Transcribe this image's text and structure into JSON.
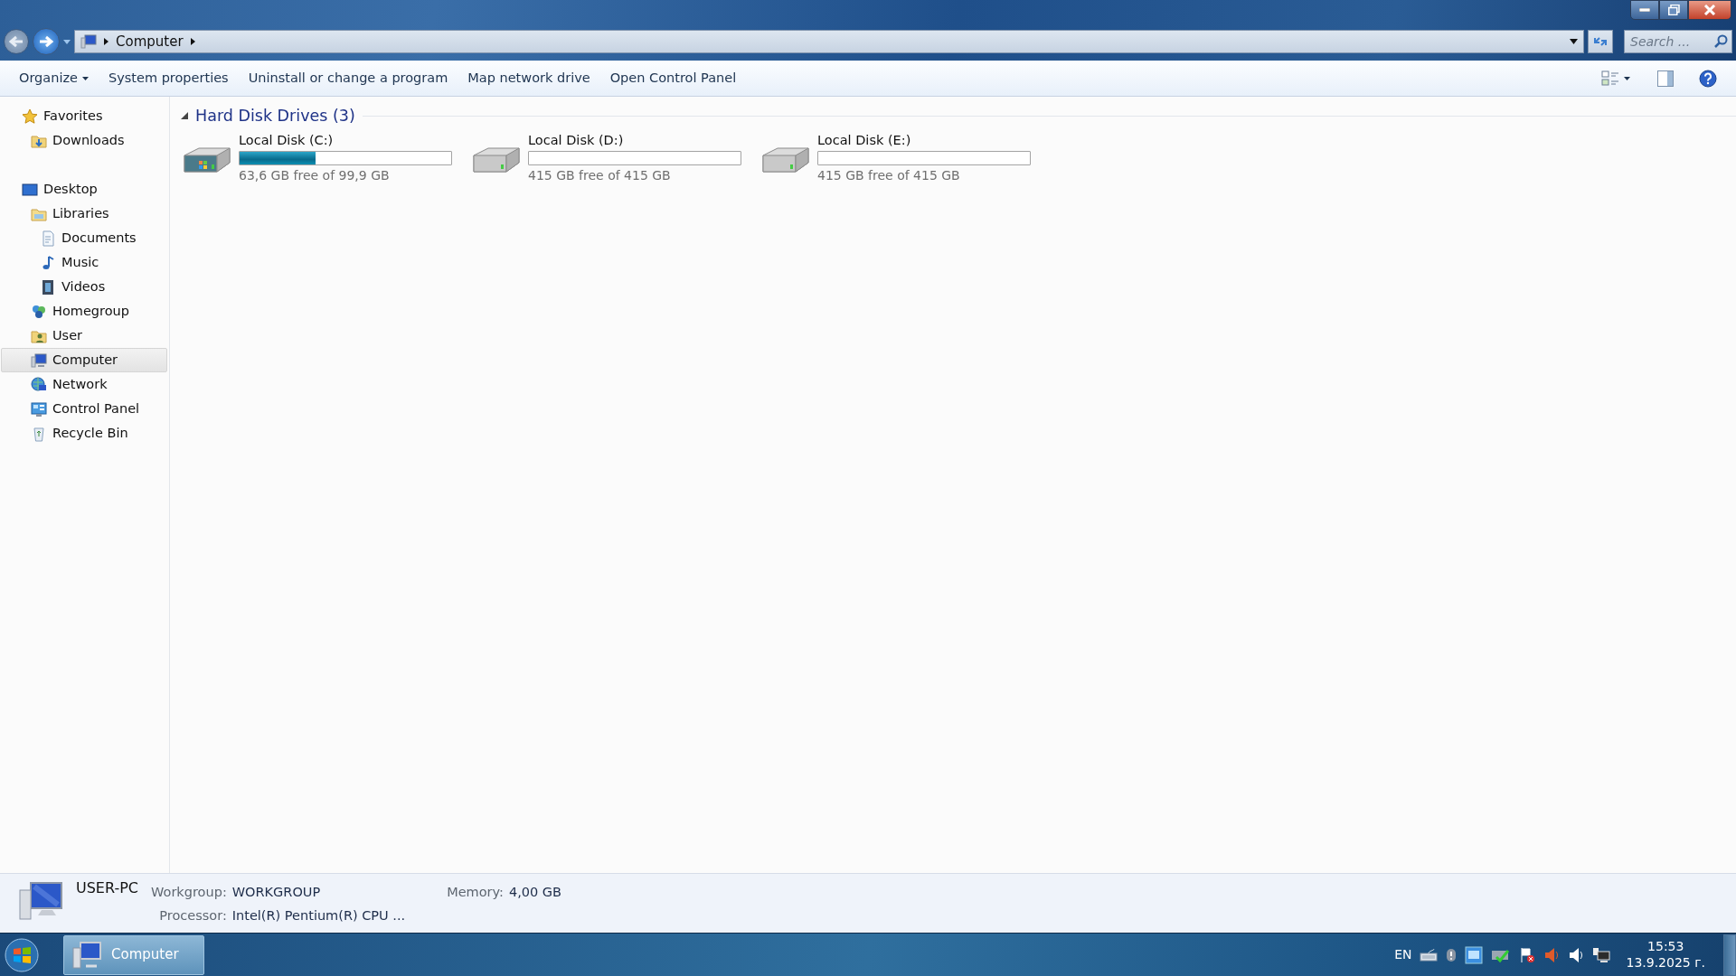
{
  "address": {
    "path": [
      "Computer"
    ],
    "search_placeholder": "Search ..."
  },
  "toolbar": {
    "items": [
      {
        "label": "Organize",
        "dropdown": true
      },
      {
        "label": "System properties",
        "dropdown": false
      },
      {
        "label": "Uninstall or change a program",
        "dropdown": false
      },
      {
        "label": "Map network drive",
        "dropdown": false
      },
      {
        "label": "Open Control Panel",
        "dropdown": false
      }
    ]
  },
  "sidebar": {
    "groups": [
      {
        "items": [
          {
            "label": "Favorites",
            "selected": false,
            "children": [
              {
                "label": "Downloads",
                "selected": false
              }
            ]
          }
        ]
      },
      {
        "items": [
          {
            "label": "Desktop",
            "selected": false,
            "children": [
              {
                "label": "Libraries",
                "selected": false,
                "children": [
                  {
                    "label": "Documents",
                    "selected": false
                  },
                  {
                    "label": "Music",
                    "selected": false
                  },
                  {
                    "label": "Videos",
                    "selected": false
                  }
                ]
              },
              {
                "label": "Homegroup",
                "selected": false
              },
              {
                "label": "User",
                "selected": false
              },
              {
                "label": "Computer",
                "selected": true
              },
              {
                "label": "Network",
                "selected": false
              },
              {
                "label": "Control Panel",
                "selected": false
              },
              {
                "label": "Recycle Bin",
                "selected": false
              }
            ]
          }
        ]
      }
    ]
  },
  "content": {
    "groups": [
      {
        "title": "Hard Disk Drives (3)",
        "expanded": true,
        "drives": [
          {
            "name": "Local Disk (C:)",
            "system": true,
            "level": 0.36,
            "free": "63,6 GB free of 99,9 GB"
          },
          {
            "name": "Local Disk (D:)",
            "system": false,
            "level": 0,
            "free": "415 GB free of 415 GB"
          },
          {
            "name": "Local Disk (E:)",
            "system": false,
            "level": 0,
            "free": "415 GB free of 415 GB"
          }
        ]
      }
    ]
  },
  "details": {
    "name": "USER-PC",
    "fields": [
      {
        "label": "Workgroup:",
        "value": "WORKGROUP"
      },
      {
        "label": "Memory:",
        "value": "4,00 GB"
      },
      {
        "label": "Processor:",
        "value": "Intel(R) Pentium(R) CPU ..."
      }
    ]
  },
  "taskbar": {
    "tasks": [
      {
        "label": "Computer",
        "selected": true
      }
    ],
    "language": "EN",
    "time": "15:53",
    "date": "13.9.2025 г."
  }
}
